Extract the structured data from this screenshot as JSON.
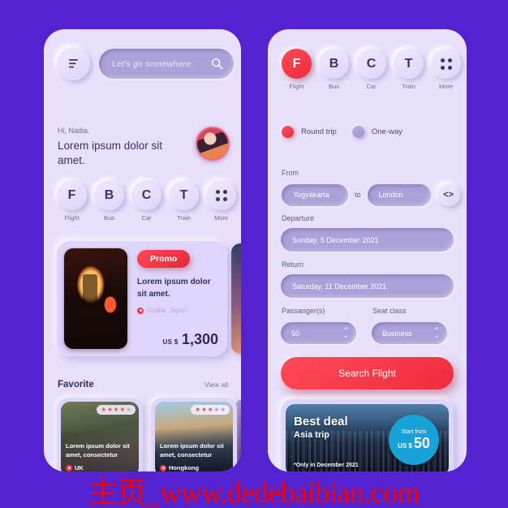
{
  "colors": {
    "background": "#5422cf",
    "card": "#e7e0fb",
    "accent_red": "#ee2b3e",
    "accent_blue": "#17a2d8",
    "field": "#aaa2d8",
    "text_dark": "#342d5c",
    "text_muted": "#6f6a93"
  },
  "watermark": "主页_www.dedebaibian.com",
  "left_screen": {
    "menu_icon": "hamburger-icon",
    "search": {
      "placeholder": "Let's go somewhere",
      "icon": "search-icon"
    },
    "greeting": {
      "hi": "Hi, Nadia.",
      "title": "Lorem ipsum dolor sit amet."
    },
    "avatar": "user-avatar",
    "categories": [
      {
        "letter": "F",
        "label": "Flight",
        "active": false
      },
      {
        "letter": "B",
        "label": "Bus",
        "active": false
      },
      {
        "letter": "C",
        "label": "Car",
        "active": false
      },
      {
        "letter": "T",
        "label": "Train",
        "active": false
      },
      {
        "letter": "",
        "label": "More",
        "active": false,
        "icon": "grid-dots-icon"
      }
    ],
    "promo": {
      "badge": "Promo",
      "title": "Lorem ipsum dolor sit amet.",
      "location": "Osaka, Japan.",
      "currency": "US $",
      "price": "1,300"
    },
    "favorite": {
      "title": "Favorite",
      "view_all": "View all",
      "cards": [
        {
          "text": "Lorem ipsum dolor sit amet, consectetur",
          "location": "UK",
          "stars_on": 4,
          "stars_off": 1
        },
        {
          "text": "Lorem ipsum dolor sit amet, consectetur",
          "location": "Hongkong",
          "stars_on": 3,
          "stars_off": 2
        }
      ]
    }
  },
  "right_screen": {
    "categories": [
      {
        "letter": "F",
        "label": "Flight",
        "active": true
      },
      {
        "letter": "B",
        "label": "Bus",
        "active": false
      },
      {
        "letter": "C",
        "label": "Car",
        "active": false
      },
      {
        "letter": "T",
        "label": "Train",
        "active": false
      },
      {
        "letter": "",
        "label": "More",
        "active": false,
        "icon": "grid-dots-icon"
      }
    ],
    "trip_type": {
      "round_trip": "Round trip",
      "one_way": "One-way",
      "selected": "Round trip"
    },
    "from_label": "From",
    "from_value": "Yogyakarta",
    "to_word": "to",
    "to_value": "London",
    "swap_icon": "swap-icon",
    "departure_label": "Departure",
    "departure_value": "Sunday, 5 December 2021",
    "return_label": "Return",
    "return_value": "Saturday, 11 December 2021",
    "passenger_label": "Passanger(s)",
    "passenger_value": "50",
    "seat_label": "Seat class",
    "seat_value": "Business",
    "search_button": "Search Flight",
    "deal": {
      "title": "Best deal",
      "subtitle": "Asia trip",
      "note": "*Only in December 2021",
      "badge_top": "Start from",
      "badge_currency": "US $",
      "badge_amount": "50"
    }
  }
}
